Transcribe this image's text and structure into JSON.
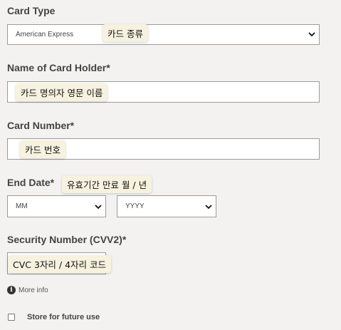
{
  "card_type": {
    "label": "Card Type",
    "selected": "American Express",
    "tooltip": "카드 종류"
  },
  "card_holder": {
    "label": "Name of Card Holder*",
    "tooltip": "카드 명의자 영문 이름"
  },
  "card_number": {
    "label": "Card Number*",
    "tooltip": "카드 번호"
  },
  "end_date": {
    "label": "End Date*",
    "tooltip": "유효기간 만료 월 / 년",
    "month_selected": "MM",
    "year_selected": "YYYY"
  },
  "security": {
    "label": "Security Number (CVV2)*",
    "tooltip": "CVC 3자리 / 4자리 코드"
  },
  "more_info": {
    "icon": "info-icon",
    "glyph": "i",
    "label": "More info"
  },
  "store": {
    "label": "Store for future use",
    "checked": false
  },
  "colors": {
    "background": "#f3f2f1",
    "field_border": "#9b9b9b",
    "tooltip_bg": "#f6f2df"
  }
}
